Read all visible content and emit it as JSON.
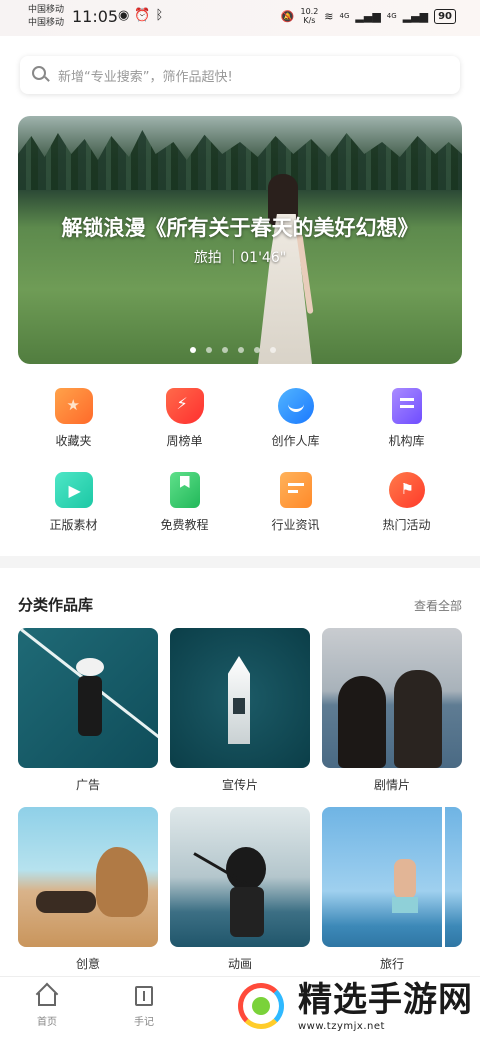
{
  "status_bar": {
    "carrier_1": "中国移动",
    "carrier_2": "中国移动",
    "time": "11:05",
    "net_speed_value": "10.2",
    "net_speed_unit": "K/s",
    "signal_1": "4G",
    "signal_2": "4G",
    "battery": "90"
  },
  "search": {
    "placeholder": "新增“专业搜索”，筛作品超快!"
  },
  "banner": {
    "title": "解锁浪漫《所有关于春天的美好幻想》",
    "subtitle": "旅拍 ｜01'46\"",
    "dots_total": 6,
    "dots_active": 1
  },
  "quick_links": [
    {
      "label": "收藏夹",
      "icon": "folder-star-icon",
      "color": "#ff7a3d"
    },
    {
      "label": "周榜单",
      "icon": "trophy-icon",
      "color": "#ff4a3a"
    },
    {
      "label": "创作人库",
      "icon": "creator-face-icon",
      "color": "#2b8cff"
    },
    {
      "label": "机构库",
      "icon": "building-icon",
      "color": "#8a6bff"
    },
    {
      "label": "正版素材",
      "icon": "media-play-icon",
      "color": "#28d6b6"
    },
    {
      "label": "免费教程",
      "icon": "book-icon",
      "color": "#3ccf6e"
    },
    {
      "label": "行业资讯",
      "icon": "news-icon",
      "color": "#ff9a3d"
    },
    {
      "label": "热门活动",
      "icon": "flag-icon",
      "color": "#ff4a3a"
    }
  ],
  "category_section": {
    "title": "分类作品库",
    "see_all": "查看全部",
    "items": [
      {
        "label": "广告"
      },
      {
        "label": "宣传片"
      },
      {
        "label": "剧情片"
      },
      {
        "label": "创意"
      },
      {
        "label": "动画"
      },
      {
        "label": "旅行"
      }
    ]
  },
  "bottom_nav": {
    "items": [
      {
        "label": "首页",
        "icon": "home-icon"
      },
      {
        "label": "手记",
        "icon": "notebook-icon"
      }
    ]
  },
  "watermark": {
    "name": "精选手游网",
    "url": "www.tzymjx.net"
  }
}
